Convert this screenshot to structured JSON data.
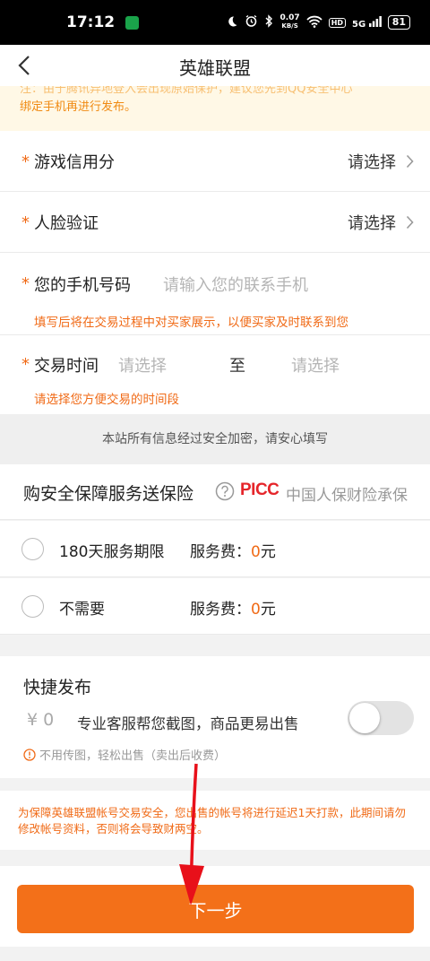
{
  "status_bar": {
    "time": "17:12",
    "net_speed_value": "0.07",
    "net_speed_unit": "KB/S",
    "hd": "HD",
    "signal": "5G",
    "battery": "81"
  },
  "nav": {
    "title": "英雄联盟"
  },
  "warning_banner": {
    "line_cut": "注：由于腾讯异地登入会出现原始保护，建议您先到QQ安全中心",
    "line2": "绑定手机再进行发布。"
  },
  "form": {
    "required_mark": "*",
    "credit": {
      "label": "游戏信用分",
      "value": "请选择"
    },
    "face": {
      "label": "人脸验证",
      "value": "请选择"
    },
    "phone": {
      "label": "您的手机号码",
      "placeholder": "请输入您的联系手机",
      "hint": "填写后将在交易过程中对买家展示，以便买家及时联系到您"
    },
    "trade_time": {
      "label": "交易时间",
      "start_placeholder": "请选择",
      "separator": "至",
      "end_placeholder": "请选择",
      "hint": "请选择您方便交易的时间段"
    }
  },
  "secure_note": "本站所有信息经过安全加密，请安心填写",
  "insurance": {
    "title": "购安全保障服务送保险",
    "logo": "PICC",
    "underwriter": "中国人保财险承保",
    "options": [
      {
        "label": "180天服务期限",
        "fee_label": "服务费：",
        "fee": "0",
        "unit": "元"
      },
      {
        "label": "不需要",
        "fee_label": "服务费：",
        "fee": "0",
        "unit": "元"
      }
    ]
  },
  "quick_publish": {
    "title": "快捷发布",
    "price": "¥ 0",
    "description": "专业客服帮您截图，商品更易出售",
    "hint": "不用传图，轻松出售（卖出后收费）",
    "enabled": false
  },
  "notice": "为保障英雄联盟帐号交易安全，您出售的帐号将进行延迟1天打款，此期间请勿修改帐号资料，否则将会导致财两空。",
  "next_button": "下一步",
  "colors": {
    "accent": "#f37019",
    "warning_text": "#f06a16",
    "picc_red": "#e5252a",
    "annotation_arrow": "#e8101a"
  }
}
